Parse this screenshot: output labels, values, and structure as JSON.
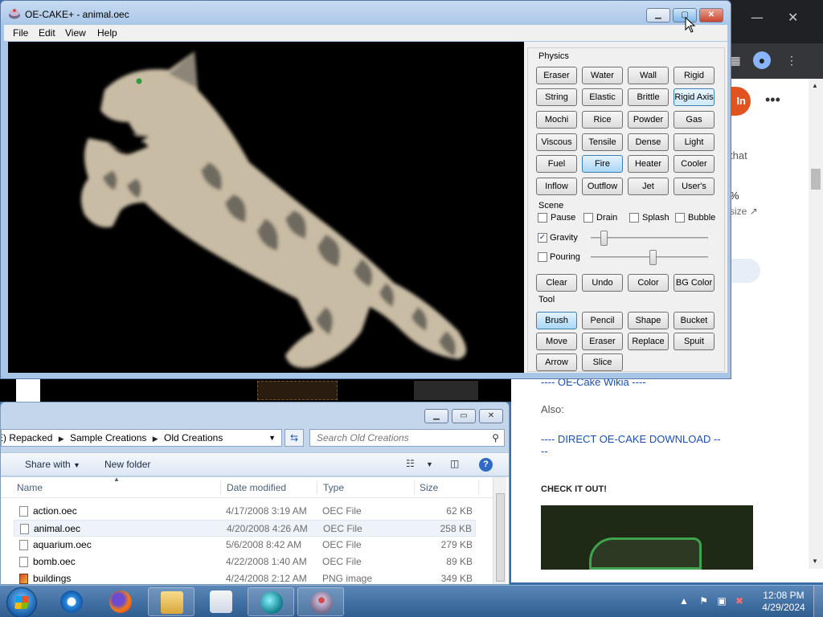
{
  "oe_window": {
    "title": "OE-CAKE+ - animal.oec",
    "menu": [
      "File",
      "Edit",
      "View",
      "Help"
    ],
    "physics_group": "Physics",
    "physics_buttons": [
      "Eraser",
      "Water",
      "Wall",
      "Rigid",
      "String",
      "Elastic",
      "Brittle",
      "Rigid Axis",
      "Mochi",
      "Rice",
      "Powder",
      "Gas",
      "Viscous",
      "Tensile",
      "Dense",
      "Light",
      "Fuel",
      "Fire",
      "Heater",
      "Cooler",
      "Inflow",
      "Outflow",
      "Jet",
      "User's"
    ],
    "physics_selected": "Fire",
    "scene_group": "Scene",
    "scene_checks": [
      {
        "label": "Pause",
        "checked": false
      },
      {
        "label": "Drain",
        "checked": false
      },
      {
        "label": "Splash",
        "checked": false
      },
      {
        "label": "Bubble",
        "checked": false
      }
    ],
    "gravity": {
      "label": "Gravity",
      "checked": true,
      "level": 0.08
    },
    "pouring": {
      "label": "Pouring",
      "checked": false,
      "level": 0.5
    },
    "scene_buttons": [
      "Clear",
      "Undo",
      "Color",
      "BG Color"
    ],
    "tool_group": "Tool",
    "tool_buttons": [
      "Brush",
      "Pencil",
      "Shape",
      "Bucket",
      "Move",
      "Eraser",
      "Replace",
      "Spuit",
      "Arrow",
      "Slice"
    ],
    "tool_selected": "Brush"
  },
  "explorer": {
    "breadcrumb": [
      "E) Repacked",
      "Sample Creations",
      "Old Creations"
    ],
    "search_placeholder": "Search Old Creations",
    "share_with": "Share with",
    "new_folder": "New folder",
    "columns": {
      "name": "Name",
      "date": "Date modified",
      "type": "Type",
      "size": "Size"
    },
    "files": [
      {
        "name": "action.oec",
        "date": "4/17/2008 3:19 AM",
        "type": "OEC File",
        "size": "62 KB"
      },
      {
        "name": "animal.oec",
        "date": "4/20/2008 4:26 AM",
        "type": "OEC File",
        "size": "258 KB"
      },
      {
        "name": "aquarium.oec",
        "date": "5/6/2008 8:42 AM",
        "type": "OEC File",
        "size": "279 KB"
      },
      {
        "name": "bomb.oec",
        "date": "4/22/2008 1:40 AM",
        "type": "OEC File",
        "size": "89 KB"
      },
      {
        "name": "buildings",
        "date": "4/24/2008 2:12 AM",
        "type": "PNG image",
        "size": "349 KB"
      }
    ],
    "selected_file": "animal.oec"
  },
  "browser_bg": {
    "signin": "In",
    "text_that": "that",
    "percent": "%",
    "size_link": "size",
    "wiki_link": "---- OE-Cake Wikia ----",
    "also": "Also:",
    "download_link": "---- DIRECT OE-CAKE DOWNLOAD ----",
    "check": "CHECK IT OUT!"
  },
  "taskbar": {
    "time": "12:08 PM",
    "date": "4/29/2024"
  },
  "colors": {
    "selected_button": "#a9d6f5",
    "canvas_bg": "#000000",
    "cat_body": "#c7b9a2",
    "cat_stripes": "#6f6a5c",
    "taskbar": "#2f5d91"
  }
}
